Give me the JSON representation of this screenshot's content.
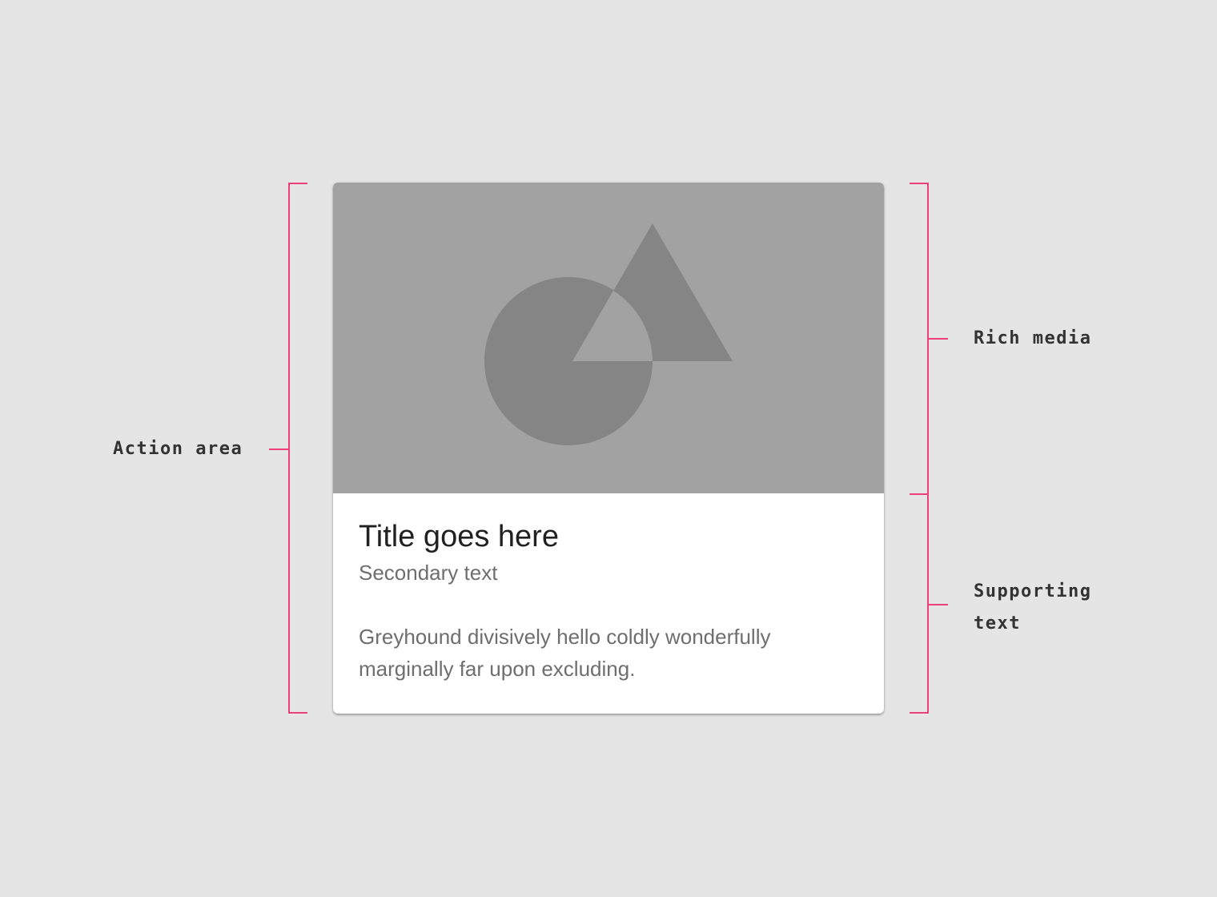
{
  "card": {
    "title": "Title goes here",
    "secondary": "Secondary text",
    "body": "Greyhound divisively hello coldly wonderfully marginally far upon excluding."
  },
  "annotations": {
    "action_area": "Action area",
    "rich_media": "Rich media",
    "supporting_text": "Supporting text"
  },
  "colors": {
    "background": "#e5e5e5",
    "card": "#ffffff",
    "media": "#a2a2a2",
    "shapes": "#858585",
    "annotation_line": "#ec407a",
    "title_text": "#212121",
    "secondary_text": "#6e6e6e",
    "annotation_text": "#333333"
  },
  "icons": {
    "media_placeholder": "shapes-placeholder-icon"
  }
}
